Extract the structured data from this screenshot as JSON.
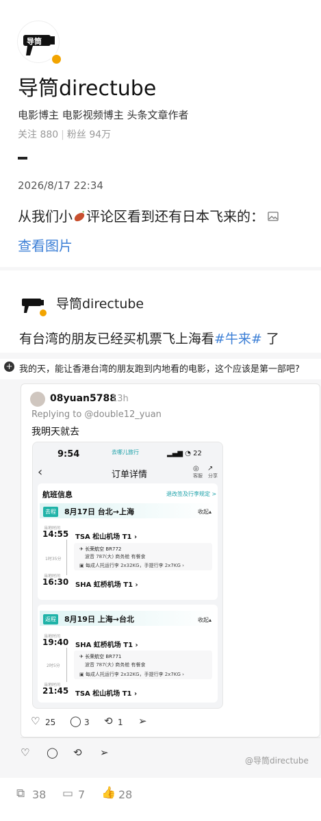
{
  "profile": {
    "name": "导筒directube",
    "bio": "电影博主 电影视频博主 头条文章作者",
    "following_label": "关注 880",
    "followers_label": "粉丝 94万",
    "avatar_logo_text": "导筒"
  },
  "post": {
    "date": "2026/8/17 22:34",
    "text_before": "从我们小",
    "text_after": "评论区看到还有日本飞来的：",
    "view_pics": "查看图片"
  },
  "embed": {
    "name": "导筒directube",
    "text_before": "有台湾的朋友已经买机票飞上海看",
    "hashtag": "#牛来#",
    "text_after": " 了",
    "comment": "我的天，能让香港台湾的朋友跑到内地看的电影，这个应该是第一部吧?",
    "reply": {
      "username": "08yuan5788",
      "time": "13h",
      "replying_to": "Replying to @double12_yuan",
      "text": "我明天就去",
      "likes": "25",
      "comments": "3",
      "reposts": "1"
    }
  },
  "phone": {
    "time": "9:54",
    "brand": "去哪儿旅行",
    "status": "▂▄▆ ◔ 22",
    "title": "订单详情",
    "icon1_label": "客服",
    "icon2_label": "分享",
    "section_title": "航班信息",
    "policy_link": "退改签及行李规定 >",
    "collapse_label": "收起▴",
    "dep_label": "当地时间",
    "arr_label": "当地时间",
    "seg1": {
      "tag": "去程",
      "route": "8月17日 台北→上海",
      "dep_time": "14:55",
      "dep_port": "TSA 松山机场 T1 ›",
      "duration": "1时35分",
      "airline": "长荣航空 BR772",
      "aircraft": "波音 787(大)   商务舱   有餐食",
      "baggage": "每成人托运行李 2x32KG，手提行李 2x7KG ›",
      "arr_time": "16:30",
      "arr_port": "SHA 虹桥机场 T1 ›"
    },
    "seg2": {
      "tag": "返程",
      "route": "8月19日 上海→台北",
      "dep_time": "19:40",
      "dep_port": "SHA 虹桥机场 T1 ›",
      "duration": "2时5分",
      "airline": "长荣航空 BR771",
      "aircraft": "波音 787(大)   商务舱   有餐食",
      "baggage": "每成人托运行李 2x32KG，手提行李 2x7KG ›",
      "arr_time": "21:45",
      "arr_port": "TSA 松山机场 T1 ›"
    }
  },
  "watermark": "@导筒directube",
  "footer": {
    "shares": "38",
    "comments": "7",
    "likes": "28"
  },
  "colors": {
    "link_blue": "#3c7fd6",
    "verify_gold": "#f2a400",
    "qunar_teal": "#1aa0a8"
  }
}
